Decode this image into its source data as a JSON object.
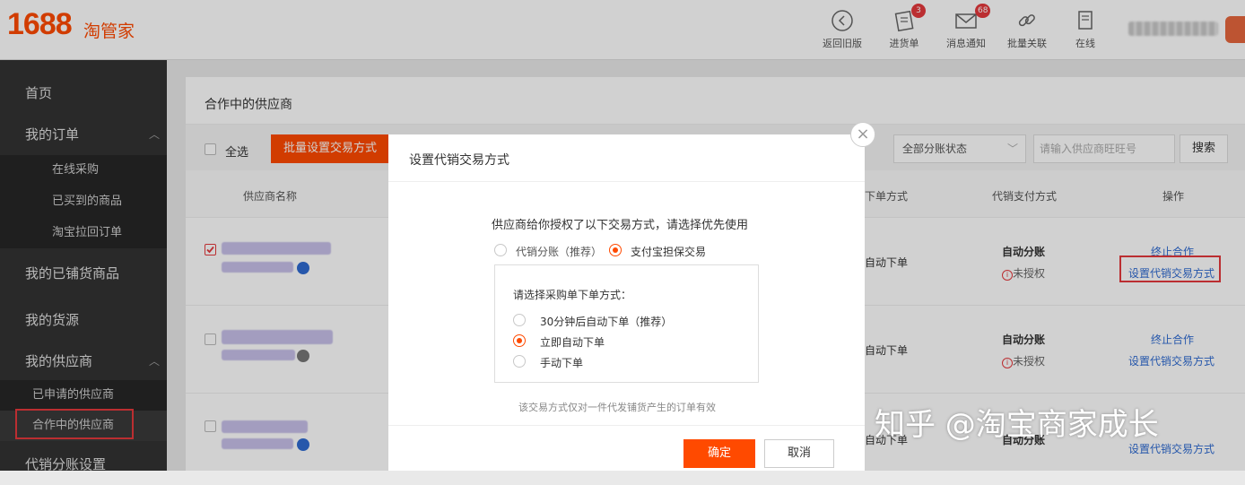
{
  "header": {
    "logo_number": "1688",
    "logo_text": "淘管家",
    "buttons": [
      {
        "label": "返回旧版",
        "icon": "back-circle-icon"
      },
      {
        "label": "进货单",
        "icon": "cart-list-icon",
        "badge": "3"
      },
      {
        "label": "消息通知",
        "icon": "envelope-icon",
        "badge": "68"
      },
      {
        "label": "批量关联",
        "icon": "link-icon"
      },
      {
        "label": "在线",
        "icon": "document-icon"
      }
    ]
  },
  "sidebar": {
    "home": "首页",
    "my_orders": "我的订单",
    "order_items": [
      "在线采购",
      "已买到的商品",
      "淘宝拉回订单"
    ],
    "distributed_goods": "我的已铺货商品",
    "my_sources": "我的货源",
    "my_suppliers": "我的供应商",
    "supplier_items": [
      "已申请的供应商",
      "合作中的供应商"
    ],
    "split_settings": "代销分账设置"
  },
  "main": {
    "page_title": "合作中的供应商",
    "select_all": "全选",
    "batch_button": "批量设置交易方式",
    "split_filter": "全部分账状态",
    "search_placeholder": "请输入供应商旺旺号",
    "search_button": "搜索",
    "columns": {
      "supplier": "供应商名称",
      "order_method": "下单方式",
      "pay_method": "代销支付方式",
      "actions": "操作"
    },
    "rows": [
      {
        "order_method": "自动下单",
        "pay_method": "自动分账",
        "status": "未授权",
        "end_link": "终止合作",
        "set_link": "设置代销交易方式"
      },
      {
        "order_method": "自动下单",
        "pay_method": "自动分账",
        "status": "未授权",
        "end_link": "终止合作",
        "set_link": "设置代销交易方式"
      },
      {
        "order_method": "自动下单",
        "pay_method": "自动分账",
        "status": "",
        "end_link": "",
        "set_link": "设置代销交易方式"
      }
    ]
  },
  "modal": {
    "title": "设置代销交易方式",
    "prompt": "供应商给你授权了以下交易方式，请选择优先使用",
    "option_split": "代销分账（推荐）",
    "option_alipay": "支付宝担保交易",
    "sub_prompt": "请选择采购单下单方式：",
    "sub_options": [
      "30分钟后自动下单（推荐）",
      "立即自动下单",
      "手动下单"
    ],
    "note": "该交易方式仅对一件代发铺货产生的订单有效",
    "confirm": "确定",
    "cancel": "取消"
  },
  "watermark": "知乎 @淘宝商家成长",
  "colors": {
    "brand": "#ff4a00",
    "link": "#2f6bd1",
    "sidebar": "#333333",
    "highlight": "#e4393c"
  }
}
